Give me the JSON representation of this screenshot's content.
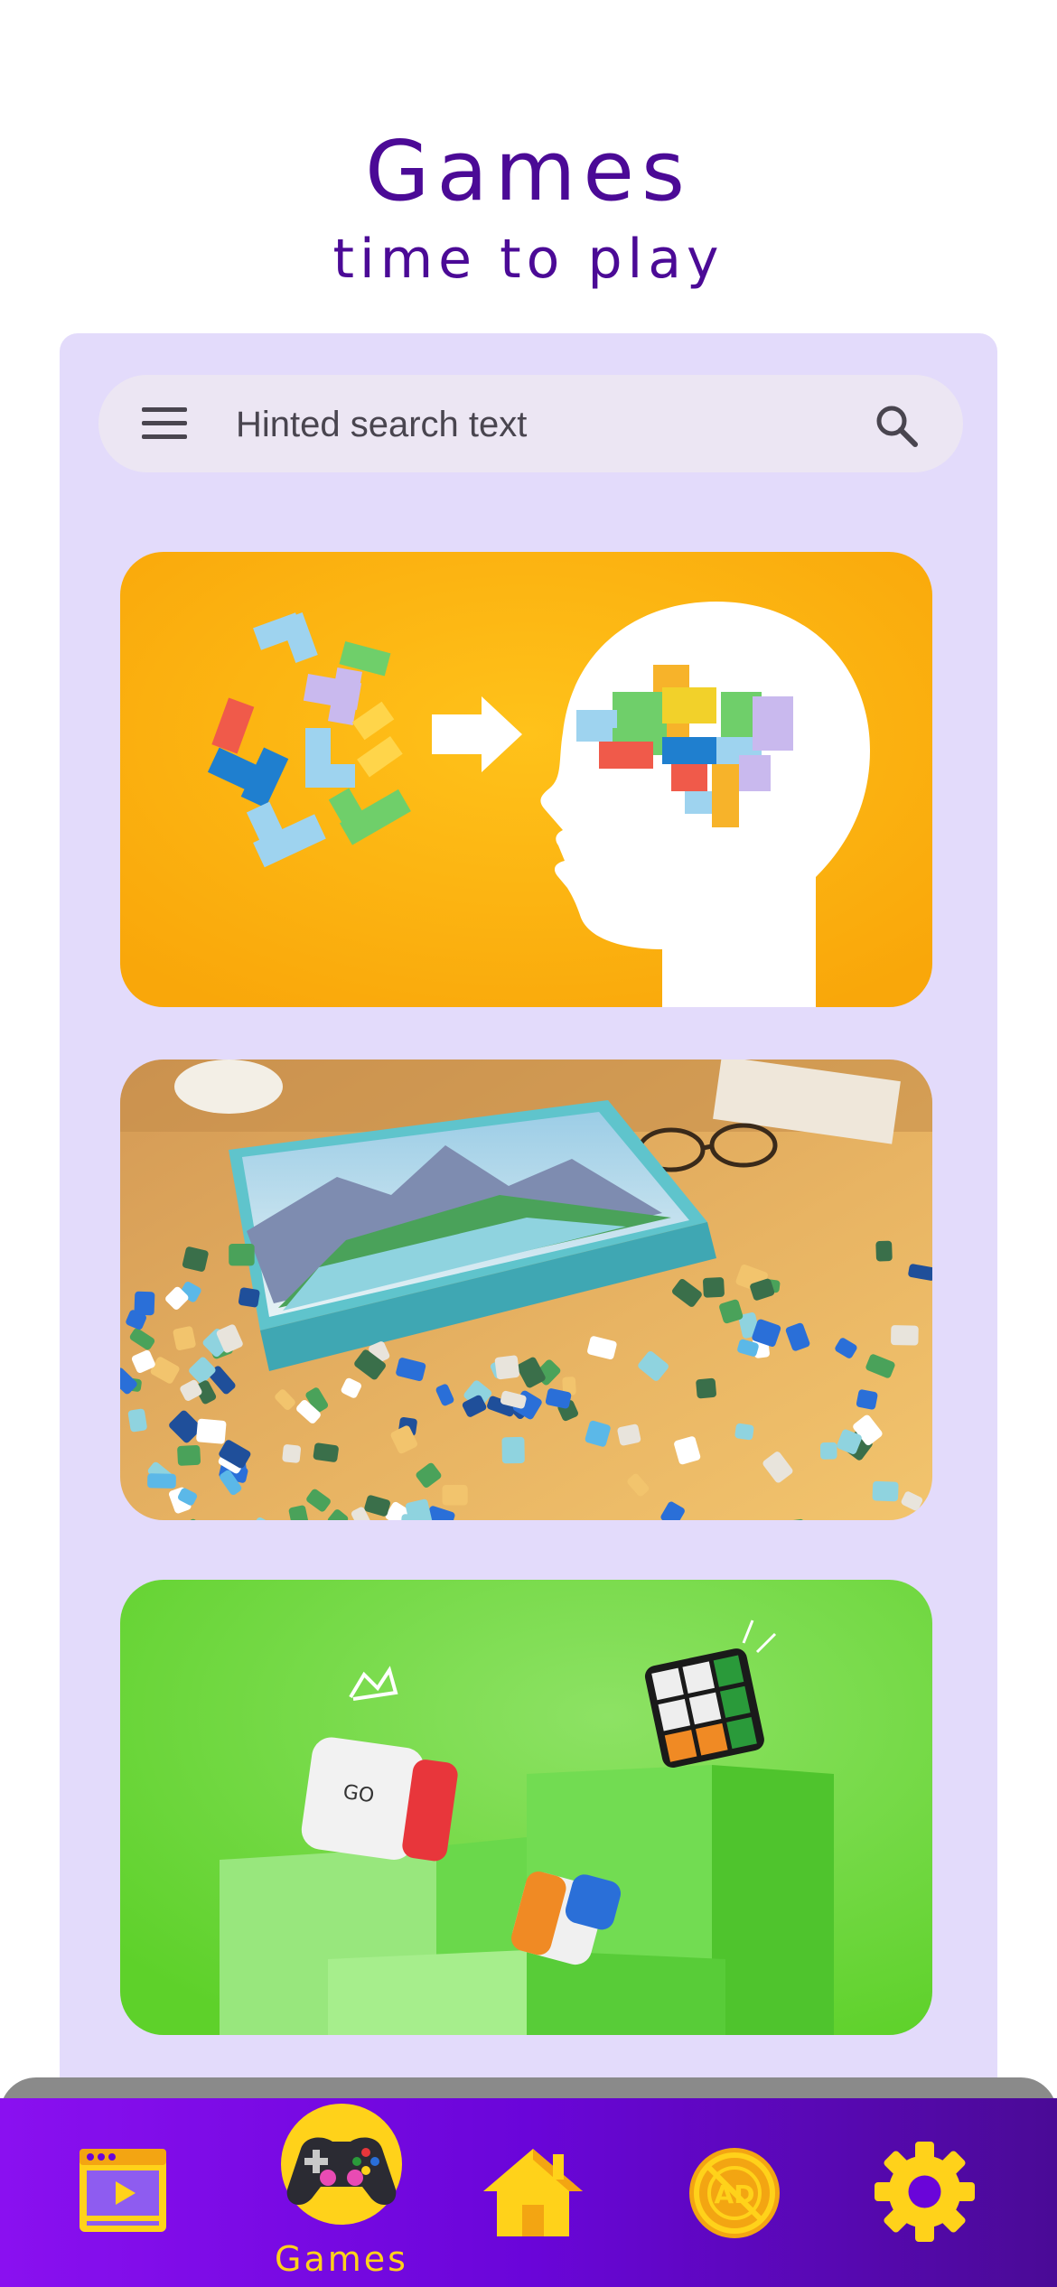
{
  "header": {
    "title": "Games",
    "subtitle": "time to play"
  },
  "search": {
    "placeholder": "Hinted search text",
    "menu_icon": "menu-icon",
    "search_icon": "search-icon"
  },
  "cards": [
    {
      "name": "brain-puzzle-card",
      "image": "tetris pieces forming a brain in a head silhouette on orange background"
    },
    {
      "name": "jigsaw-puzzle-card",
      "image": "jigsaw puzzle box with mountain lake scene and scattered pieces on a table"
    },
    {
      "name": "cube-puzzle-card",
      "image": "smart puzzle cubes on green podiums"
    }
  ],
  "navbar": {
    "items": [
      {
        "icon": "video-player-icon",
        "label": ""
      },
      {
        "icon": "gamepad-icon",
        "label": "Games",
        "active": true
      },
      {
        "icon": "home-icon",
        "label": ""
      },
      {
        "icon": "no-ads-icon",
        "label": ""
      },
      {
        "icon": "gear-icon",
        "label": ""
      }
    ]
  },
  "colors": {
    "title": "#4b0a96",
    "panel": "#e3dbfb",
    "search_bar": "#ece6f3",
    "nav_gradient_start": "#8a10f0",
    "nav_gradient_end": "#4a0a96",
    "nav_icon": "#ffd21a"
  }
}
